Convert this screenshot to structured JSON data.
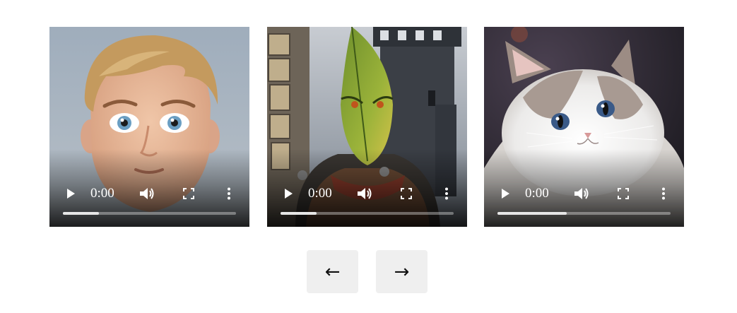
{
  "videos": [
    {
      "name": "video-boy",
      "time": "0:00",
      "progress": 0.21,
      "icon": "play-icon"
    },
    {
      "name": "video-knight",
      "time": "0:00",
      "progress": 0.21,
      "icon": "play-icon"
    },
    {
      "name": "video-cat",
      "time": "0:00",
      "progress": 0.4,
      "icon": "play-icon"
    }
  ],
  "nav": {
    "prev_label": "←",
    "next_label": "→"
  },
  "icons": [
    "play-icon",
    "volume-icon",
    "fullscreen-icon",
    "more-options-icon"
  ],
  "colors": {
    "button_bg": "#efefef",
    "page_bg": "#ffffff"
  }
}
